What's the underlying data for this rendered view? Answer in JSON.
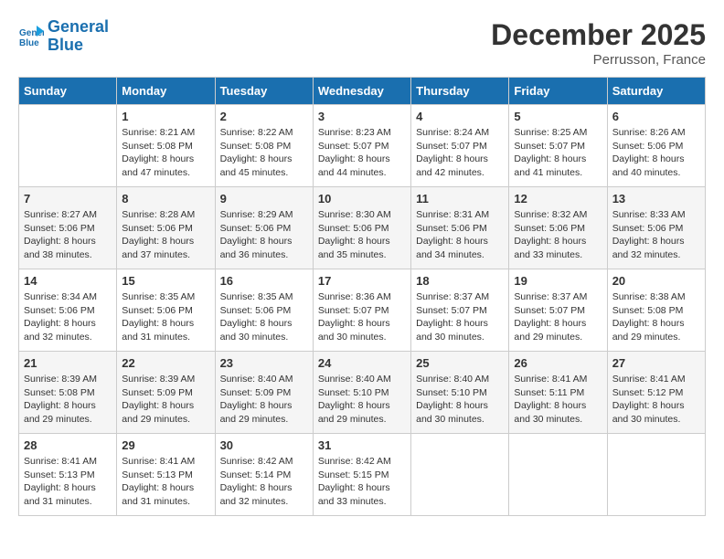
{
  "header": {
    "logo_line1": "General",
    "logo_line2": "Blue",
    "month_title": "December 2025",
    "location": "Perrusson, France"
  },
  "weekdays": [
    "Sunday",
    "Monday",
    "Tuesday",
    "Wednesday",
    "Thursday",
    "Friday",
    "Saturday"
  ],
  "weeks": [
    [
      {
        "day": "",
        "sunrise": "",
        "sunset": "",
        "daylight": ""
      },
      {
        "day": "1",
        "sunrise": "Sunrise: 8:21 AM",
        "sunset": "Sunset: 5:08 PM",
        "daylight": "Daylight: 8 hours and 47 minutes."
      },
      {
        "day": "2",
        "sunrise": "Sunrise: 8:22 AM",
        "sunset": "Sunset: 5:08 PM",
        "daylight": "Daylight: 8 hours and 45 minutes."
      },
      {
        "day": "3",
        "sunrise": "Sunrise: 8:23 AM",
        "sunset": "Sunset: 5:07 PM",
        "daylight": "Daylight: 8 hours and 44 minutes."
      },
      {
        "day": "4",
        "sunrise": "Sunrise: 8:24 AM",
        "sunset": "Sunset: 5:07 PM",
        "daylight": "Daylight: 8 hours and 42 minutes."
      },
      {
        "day": "5",
        "sunrise": "Sunrise: 8:25 AM",
        "sunset": "Sunset: 5:07 PM",
        "daylight": "Daylight: 8 hours and 41 minutes."
      },
      {
        "day": "6",
        "sunrise": "Sunrise: 8:26 AM",
        "sunset": "Sunset: 5:06 PM",
        "daylight": "Daylight: 8 hours and 40 minutes."
      }
    ],
    [
      {
        "day": "7",
        "sunrise": "Sunrise: 8:27 AM",
        "sunset": "Sunset: 5:06 PM",
        "daylight": "Daylight: 8 hours and 38 minutes."
      },
      {
        "day": "8",
        "sunrise": "Sunrise: 8:28 AM",
        "sunset": "Sunset: 5:06 PM",
        "daylight": "Daylight: 8 hours and 37 minutes."
      },
      {
        "day": "9",
        "sunrise": "Sunrise: 8:29 AM",
        "sunset": "Sunset: 5:06 PM",
        "daylight": "Daylight: 8 hours and 36 minutes."
      },
      {
        "day": "10",
        "sunrise": "Sunrise: 8:30 AM",
        "sunset": "Sunset: 5:06 PM",
        "daylight": "Daylight: 8 hours and 35 minutes."
      },
      {
        "day": "11",
        "sunrise": "Sunrise: 8:31 AM",
        "sunset": "Sunset: 5:06 PM",
        "daylight": "Daylight: 8 hours and 34 minutes."
      },
      {
        "day": "12",
        "sunrise": "Sunrise: 8:32 AM",
        "sunset": "Sunset: 5:06 PM",
        "daylight": "Daylight: 8 hours and 33 minutes."
      },
      {
        "day": "13",
        "sunrise": "Sunrise: 8:33 AM",
        "sunset": "Sunset: 5:06 PM",
        "daylight": "Daylight: 8 hours and 32 minutes."
      }
    ],
    [
      {
        "day": "14",
        "sunrise": "Sunrise: 8:34 AM",
        "sunset": "Sunset: 5:06 PM",
        "daylight": "Daylight: 8 hours and 32 minutes."
      },
      {
        "day": "15",
        "sunrise": "Sunrise: 8:35 AM",
        "sunset": "Sunset: 5:06 PM",
        "daylight": "Daylight: 8 hours and 31 minutes."
      },
      {
        "day": "16",
        "sunrise": "Sunrise: 8:35 AM",
        "sunset": "Sunset: 5:06 PM",
        "daylight": "Daylight: 8 hours and 30 minutes."
      },
      {
        "day": "17",
        "sunrise": "Sunrise: 8:36 AM",
        "sunset": "Sunset: 5:07 PM",
        "daylight": "Daylight: 8 hours and 30 minutes."
      },
      {
        "day": "18",
        "sunrise": "Sunrise: 8:37 AM",
        "sunset": "Sunset: 5:07 PM",
        "daylight": "Daylight: 8 hours and 30 minutes."
      },
      {
        "day": "19",
        "sunrise": "Sunrise: 8:37 AM",
        "sunset": "Sunset: 5:07 PM",
        "daylight": "Daylight: 8 hours and 29 minutes."
      },
      {
        "day": "20",
        "sunrise": "Sunrise: 8:38 AM",
        "sunset": "Sunset: 5:08 PM",
        "daylight": "Daylight: 8 hours and 29 minutes."
      }
    ],
    [
      {
        "day": "21",
        "sunrise": "Sunrise: 8:39 AM",
        "sunset": "Sunset: 5:08 PM",
        "daylight": "Daylight: 8 hours and 29 minutes."
      },
      {
        "day": "22",
        "sunrise": "Sunrise: 8:39 AM",
        "sunset": "Sunset: 5:09 PM",
        "daylight": "Daylight: 8 hours and 29 minutes."
      },
      {
        "day": "23",
        "sunrise": "Sunrise: 8:40 AM",
        "sunset": "Sunset: 5:09 PM",
        "daylight": "Daylight: 8 hours and 29 minutes."
      },
      {
        "day": "24",
        "sunrise": "Sunrise: 8:40 AM",
        "sunset": "Sunset: 5:10 PM",
        "daylight": "Daylight: 8 hours and 29 minutes."
      },
      {
        "day": "25",
        "sunrise": "Sunrise: 8:40 AM",
        "sunset": "Sunset: 5:10 PM",
        "daylight": "Daylight: 8 hours and 30 minutes."
      },
      {
        "day": "26",
        "sunrise": "Sunrise: 8:41 AM",
        "sunset": "Sunset: 5:11 PM",
        "daylight": "Daylight: 8 hours and 30 minutes."
      },
      {
        "day": "27",
        "sunrise": "Sunrise: 8:41 AM",
        "sunset": "Sunset: 5:12 PM",
        "daylight": "Daylight: 8 hours and 30 minutes."
      }
    ],
    [
      {
        "day": "28",
        "sunrise": "Sunrise: 8:41 AM",
        "sunset": "Sunset: 5:13 PM",
        "daylight": "Daylight: 8 hours and 31 minutes."
      },
      {
        "day": "29",
        "sunrise": "Sunrise: 8:41 AM",
        "sunset": "Sunset: 5:13 PM",
        "daylight": "Daylight: 8 hours and 31 minutes."
      },
      {
        "day": "30",
        "sunrise": "Sunrise: 8:42 AM",
        "sunset": "Sunset: 5:14 PM",
        "daylight": "Daylight: 8 hours and 32 minutes."
      },
      {
        "day": "31",
        "sunrise": "Sunrise: 8:42 AM",
        "sunset": "Sunset: 5:15 PM",
        "daylight": "Daylight: 8 hours and 33 minutes."
      },
      {
        "day": "",
        "sunrise": "",
        "sunset": "",
        "daylight": ""
      },
      {
        "day": "",
        "sunrise": "",
        "sunset": "",
        "daylight": ""
      },
      {
        "day": "",
        "sunrise": "",
        "sunset": "",
        "daylight": ""
      }
    ]
  ]
}
